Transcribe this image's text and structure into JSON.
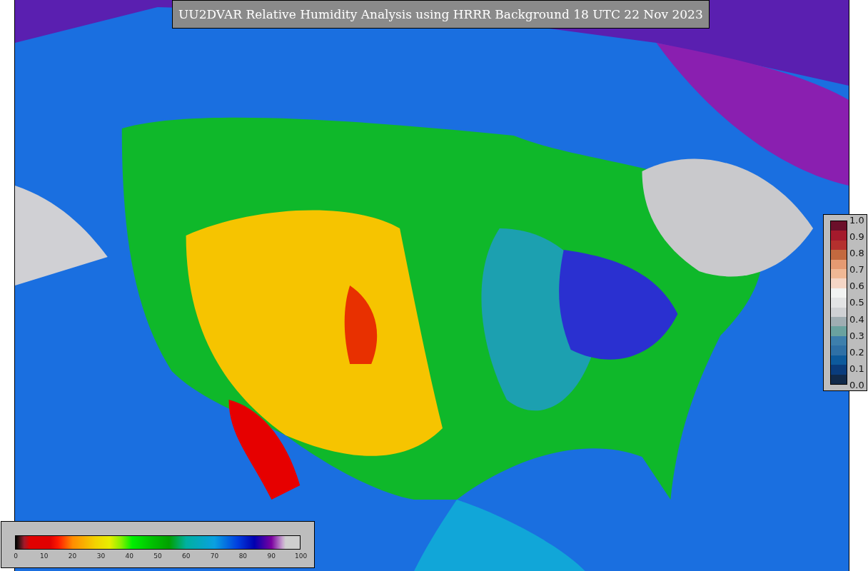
{
  "title": "UU2DVAR Relative Humidity Analysis using HRRR Background 18 UTC 22 Nov 2023",
  "humidity_colorbar": {
    "ticks": [
      "0",
      "10",
      "20",
      "30",
      "40",
      "50",
      "60",
      "70",
      "80",
      "90",
      "100"
    ]
  },
  "ratio_colorbar": {
    "ticks": [
      "1.0",
      "0.9",
      "0.8",
      "0.7",
      "0.6",
      "0.5",
      "0.4",
      "0.3",
      "0.2",
      "0.1",
      "0.0"
    ]
  }
}
